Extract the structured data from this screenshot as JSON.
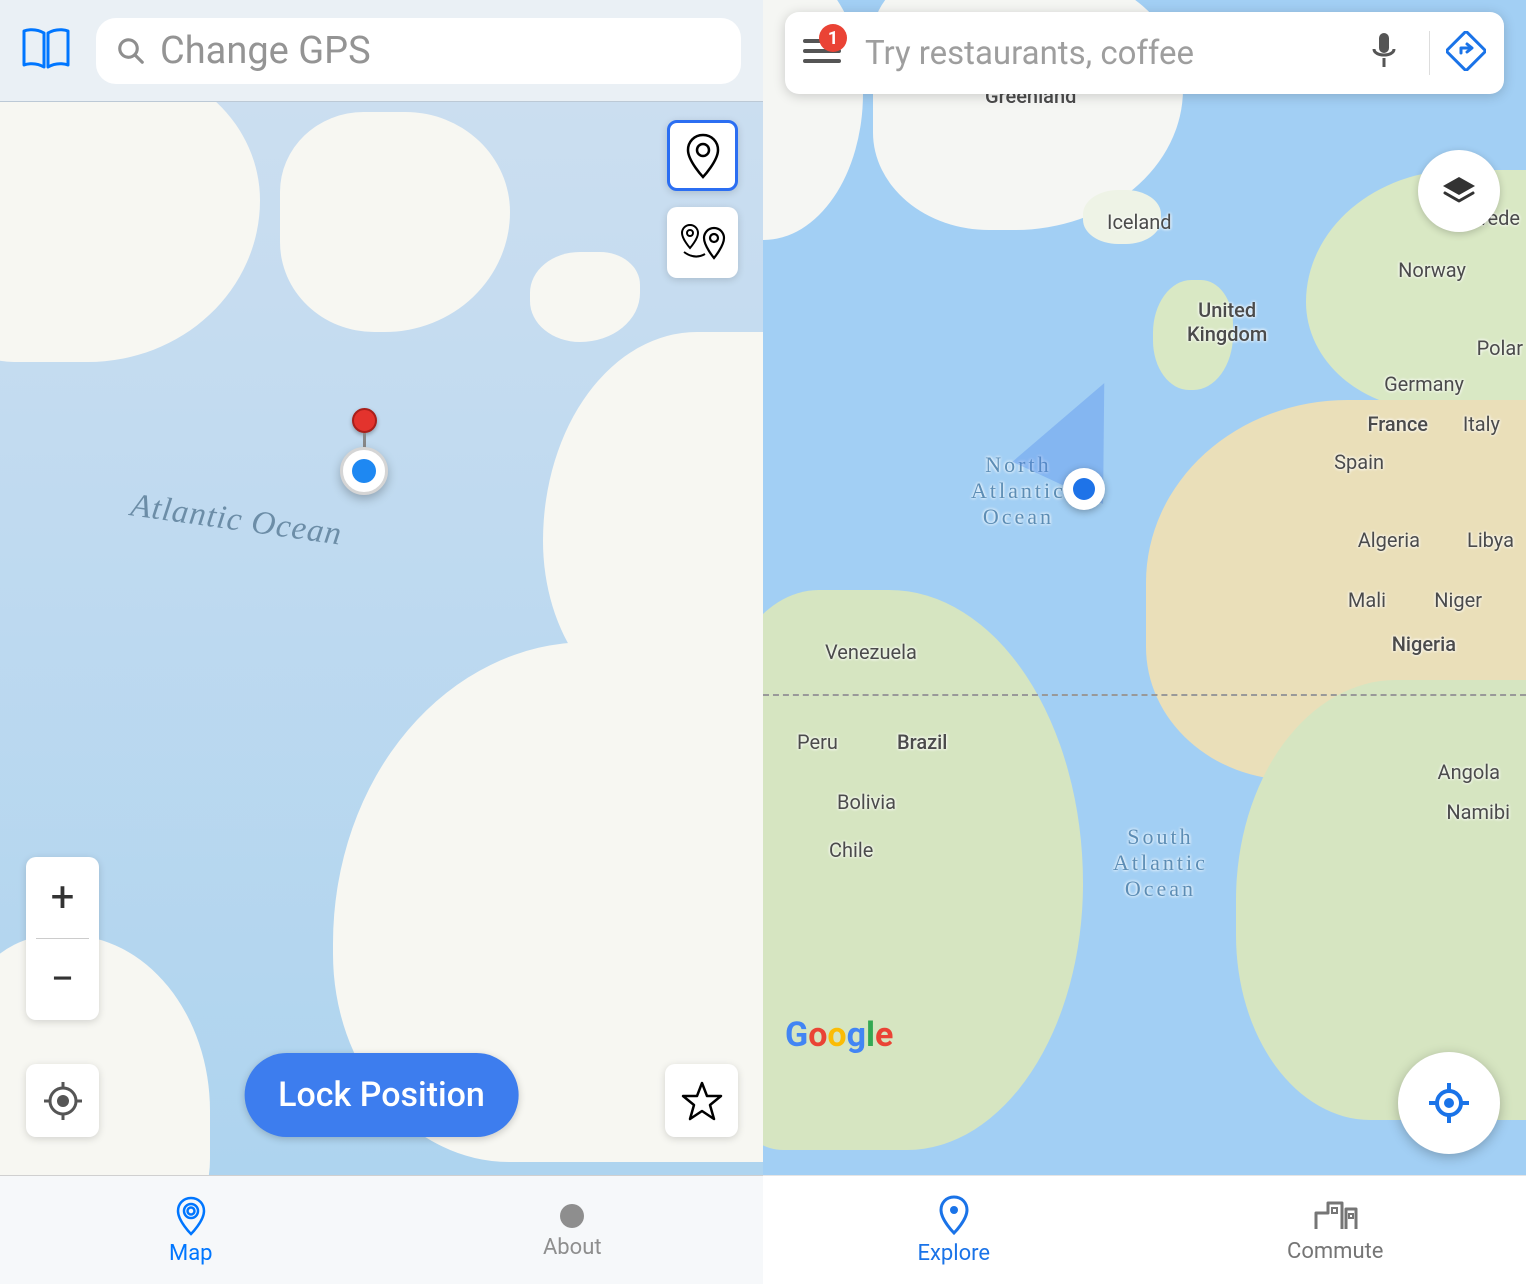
{
  "left": {
    "search_placeholder": "Change GPS",
    "ocean_label": "Atlantic Ocean",
    "lock_button": "Lock Position",
    "zoom_in": "+",
    "zoom_out": "−",
    "tabs": {
      "map": "Map",
      "about": "About"
    }
  },
  "right": {
    "search_placeholder": "Try restaurants, coffee",
    "notification_count": "1",
    "labels": {
      "greenland": "Greenland",
      "iceland": "Iceland",
      "sweden": "Swede",
      "norway": "Norway",
      "uk": "United\nKingdom",
      "poland": "Polar",
      "germany": "Germany",
      "france": "France",
      "italy": "Italy",
      "spain": "Spain",
      "algeria": "Algeria",
      "libya": "Libya",
      "mali": "Mali",
      "niger": "Niger",
      "nigeria": "Nigeria",
      "venezuela": "Venezuela",
      "peru": "Peru",
      "brazil": "Brazil",
      "bolivia": "Bolivia",
      "chile": "Chile",
      "angola": "Angola",
      "namibia": "Namibi",
      "north_atlantic": "North\nAtlantic\nOcean",
      "south_atlantic": "South\nAtlantic\nOcean"
    },
    "logo": "Google",
    "tabs": {
      "explore": "Explore",
      "commute": "Commute"
    }
  }
}
